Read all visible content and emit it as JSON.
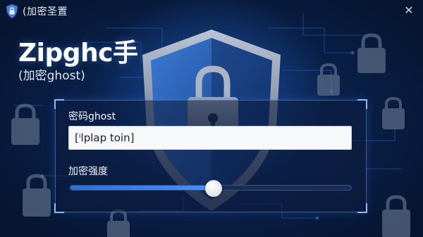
{
  "window": {
    "title": "(加密圣置",
    "close_glyph": "✕",
    "accent": "#4a90ff",
    "background": "#0b2250"
  },
  "brand": {
    "name": "Zipghc手",
    "subtitle": "(加密ghost)"
  },
  "form": {
    "password_label": "密码ghost",
    "password_value": "[ⁱlplap toin]",
    "strength_label": "加密强度",
    "strength_value": 0.51
  },
  "icons": {
    "app": "shield-lock-icon",
    "close": "close-icon",
    "background": [
      "shield-icon",
      "padlock-icon",
      "circuit-lines"
    ]
  }
}
